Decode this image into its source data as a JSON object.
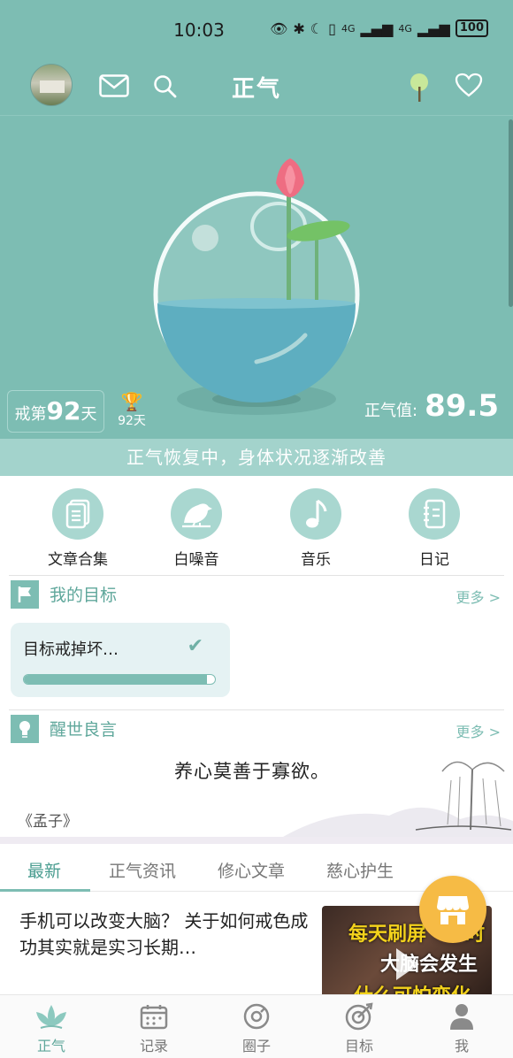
{
  "status_bar": {
    "time": "10:03",
    "network_1": "4G",
    "network_2": "4G",
    "battery": "100"
  },
  "app_bar": {
    "title": "正气"
  },
  "hero": {
    "quit_prefix": "戒第",
    "quit_days": "92",
    "quit_suffix": "天",
    "trophy_days": "92天",
    "energy_label": "正气值:",
    "energy_value": "89.5",
    "status_text": "正气恢复中，身体状况逐渐改善"
  },
  "quick_menu": [
    {
      "label": "文章合集",
      "icon": "document-icon"
    },
    {
      "label": "白噪音",
      "icon": "bird-icon"
    },
    {
      "label": "音乐",
      "icon": "music-note-icon"
    },
    {
      "label": "日记",
      "icon": "notebook-icon"
    }
  ],
  "goals": {
    "title": "我的目标",
    "more": "更多 >",
    "card_text": "目标戒掉坏…",
    "progress": 0.96
  },
  "quote": {
    "title": "醒世良言",
    "more": "更多 >",
    "text": "养心莫善于寡欲。",
    "source": "《孟子》"
  },
  "tabs": [
    {
      "label": "最新",
      "active": true
    },
    {
      "label": "正气资讯",
      "active": false
    },
    {
      "label": "修心文章",
      "active": false
    },
    {
      "label": "慈心护生",
      "active": false
    }
  ],
  "article": {
    "title": "手机可以改变大脑？ 关于如何戒色成功其实就是实习长期…",
    "thumb_line1": "每天刷屏",
    "thumb_line1_end": "时",
    "thumb_line2": "大脑会发生",
    "thumb_line3": "什么可怕变化"
  },
  "bottom_nav": [
    {
      "label": "正气",
      "icon": "lotus-icon",
      "active": true
    },
    {
      "label": "记录",
      "icon": "calendar-icon",
      "active": false
    },
    {
      "label": "圈子",
      "icon": "circle-icon",
      "active": false
    },
    {
      "label": "目标",
      "icon": "target-icon",
      "active": false
    },
    {
      "label": "我",
      "icon": "person-icon",
      "active": false
    }
  ],
  "colors": {
    "primary": "#7dbdb3",
    "accent_light": "#a9d7d0",
    "fab": "#f6bb45"
  }
}
